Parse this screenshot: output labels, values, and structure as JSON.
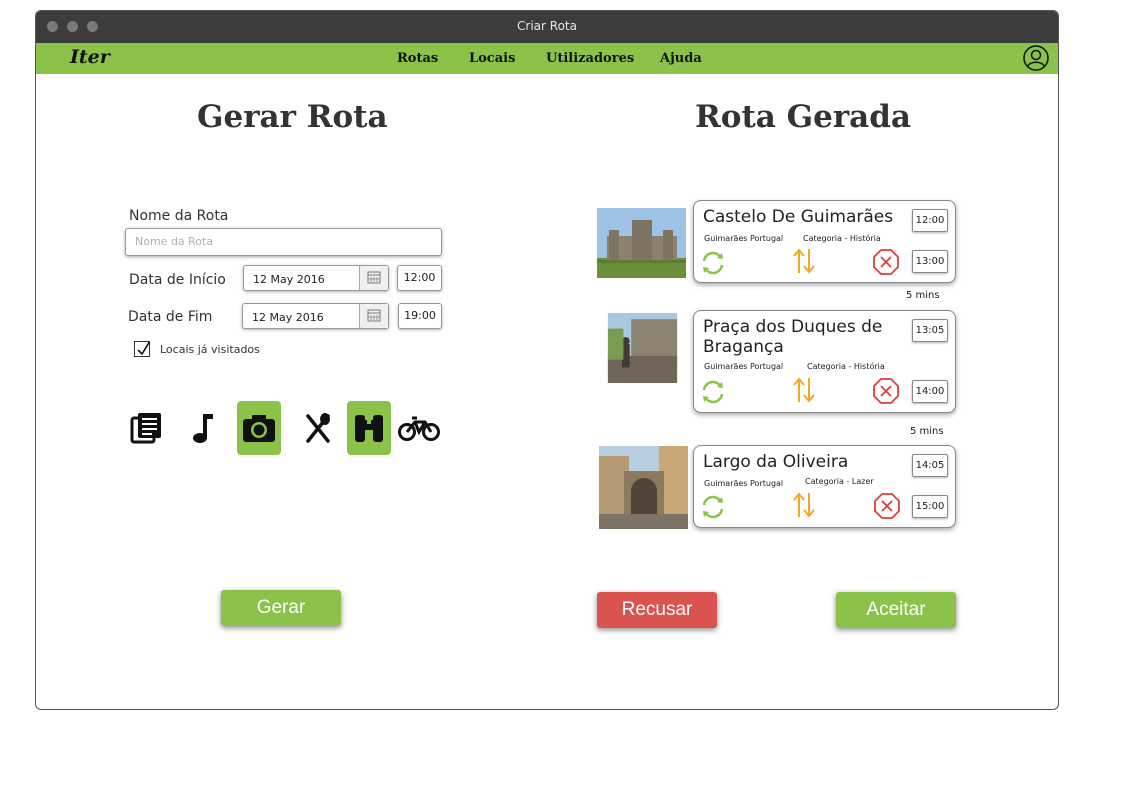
{
  "window": {
    "title": "Criar Rota"
  },
  "nav": {
    "logo": "Iter",
    "items": [
      "Rotas",
      "Locais",
      "Utilizadores",
      "Ajuda"
    ]
  },
  "form": {
    "heading": "Gerar Rota",
    "name_label": "Nome da Rota",
    "name_placeholder": "Nome da Rota",
    "start_label": "Data de Início",
    "start_date": "12 May 2016",
    "start_time": "12:00",
    "end_label": "Data de Fim",
    "end_date": "12 May 2016",
    "end_time": "19:00",
    "visited_label": "Locais já visitados",
    "visited_checked": true,
    "categories": [
      {
        "icon": "newspaper-icon",
        "active": false
      },
      {
        "icon": "music-note-icon",
        "active": false
      },
      {
        "icon": "camera-icon",
        "active": true
      },
      {
        "icon": "cutlery-icon",
        "active": false
      },
      {
        "icon": "binoculars-icon",
        "active": true
      },
      {
        "icon": "bicycle-icon",
        "active": false
      }
    ],
    "generate_button": "Gerar"
  },
  "result": {
    "heading": "Rota Gerada",
    "stops": [
      {
        "name": "Castelo De Guimarães",
        "location": "Guimarães Portugal",
        "category": "Categoria - História",
        "start": "12:00",
        "end": "13:00"
      },
      {
        "name": "Praça dos Duques de Bragança",
        "location": "Guimarães Portugal",
        "category": "Categoria - História",
        "start": "13:05",
        "end": "14:00"
      },
      {
        "name": "Largo da Oliveira",
        "location": "Guimarães Portugal",
        "category": "Categoria - Lazer",
        "start": "14:05",
        "end": "15:00"
      }
    ],
    "gaps": [
      "5 mins",
      "5 mins"
    ],
    "reject_button": "Recusar",
    "accept_button": "Aceitar"
  },
  "colors": {
    "accent": "#8bc34a",
    "danger": "#d9534f",
    "swap": "#f5a623",
    "remove": "#e03c3c"
  }
}
